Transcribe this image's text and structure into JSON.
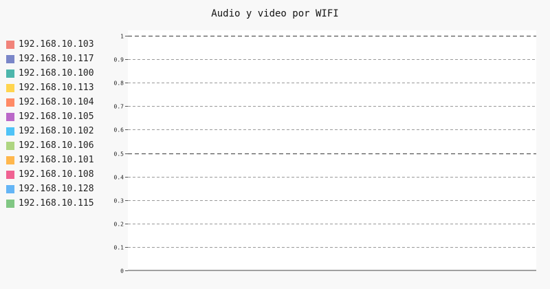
{
  "chart_data": {
    "type": "line",
    "title": "Audio y video por WIFI",
    "xlabel": "",
    "ylabel": "",
    "ylim": [
      0,
      1
    ],
    "y_ticks": [
      {
        "value": 0,
        "label": "0"
      },
      {
        "value": 0.1,
        "label": "0.1"
      },
      {
        "value": 0.2,
        "label": "0.2"
      },
      {
        "value": 0.3,
        "label": "0.3"
      },
      {
        "value": 0.4,
        "label": "0.4"
      },
      {
        "value": 0.5,
        "label": "0.5"
      },
      {
        "value": 0.6,
        "label": "0.6"
      },
      {
        "value": 0.7,
        "label": "0.7"
      },
      {
        "value": 0.8,
        "label": "0.8"
      },
      {
        "value": 0.9,
        "label": "0.9"
      },
      {
        "value": 1,
        "label": "1"
      }
    ],
    "grid": true,
    "legend_position": "left",
    "series": [
      {
        "name": "192.168.10.103",
        "color": "#f1837a",
        "values": []
      },
      {
        "name": "192.168.10.117",
        "color": "#7a86c8",
        "values": []
      },
      {
        "name": "192.168.10.100",
        "color": "#4db6ac",
        "values": []
      },
      {
        "name": "192.168.10.113",
        "color": "#ffd54f",
        "values": []
      },
      {
        "name": "192.168.10.104",
        "color": "#ff8a65",
        "values": []
      },
      {
        "name": "192.168.10.105",
        "color": "#ba68c8",
        "values": []
      },
      {
        "name": "192.168.10.102",
        "color": "#4fc3f7",
        "values": []
      },
      {
        "name": "192.168.10.106",
        "color": "#aed581",
        "values": []
      },
      {
        "name": "192.168.10.101",
        "color": "#ffb74d",
        "values": []
      },
      {
        "name": "192.168.10.108",
        "color": "#f06292",
        "values": []
      },
      {
        "name": "192.168.10.128",
        "color": "#64b5f6",
        "values": []
      },
      {
        "name": "192.168.10.115",
        "color": "#81c784",
        "values": []
      }
    ]
  }
}
